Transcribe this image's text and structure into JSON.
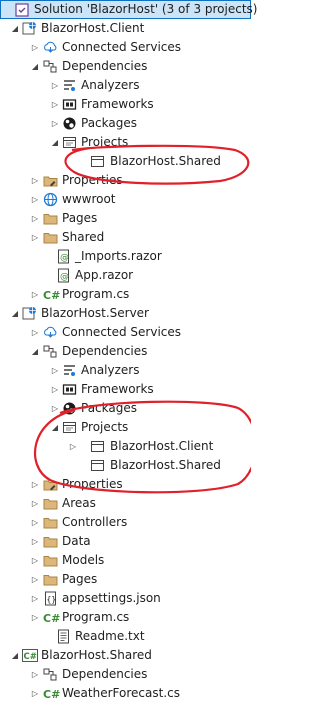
{
  "solution": {
    "label": "Solution 'BlazorHost' (3 of 3 projects)"
  },
  "client": {
    "label": "BlazorHost.Client",
    "connected": "Connected Services",
    "dependencies": "Dependencies",
    "analyzers": "Analyzers",
    "frameworks": "Frameworks",
    "packages": "Packages",
    "projects": "Projects",
    "proj_shared": "BlazorHost.Shared",
    "properties": "Properties",
    "wwwroot": "wwwroot",
    "pages": "Pages",
    "shared": "Shared",
    "imports": "_Imports.razor",
    "app": "App.razor",
    "program": "Program.cs"
  },
  "server": {
    "label": "BlazorHost.Server",
    "connected": "Connected Services",
    "dependencies": "Dependencies",
    "analyzers": "Analyzers",
    "frameworks": "Frameworks",
    "packages": "Packages",
    "projects": "Projects",
    "proj_client": "BlazorHost.Client",
    "proj_shared": "BlazorHost.Shared",
    "properties": "Properties",
    "areas": "Areas",
    "controllers": "Controllers",
    "data": "Data",
    "models": "Models",
    "pages": "Pages",
    "appsettings": "appsettings.json",
    "program": "Program.cs",
    "readme": "Readme.txt"
  },
  "sharedproj": {
    "label": "BlazorHost.Shared",
    "dependencies": "Dependencies",
    "weather": "WeatherForecast.cs"
  },
  "colors": {
    "selection": "#cce4f7",
    "selection_border": "#0e70c0",
    "annotation": "#e0202a",
    "folder": "#dcb67a",
    "csharp": "#388a34"
  }
}
